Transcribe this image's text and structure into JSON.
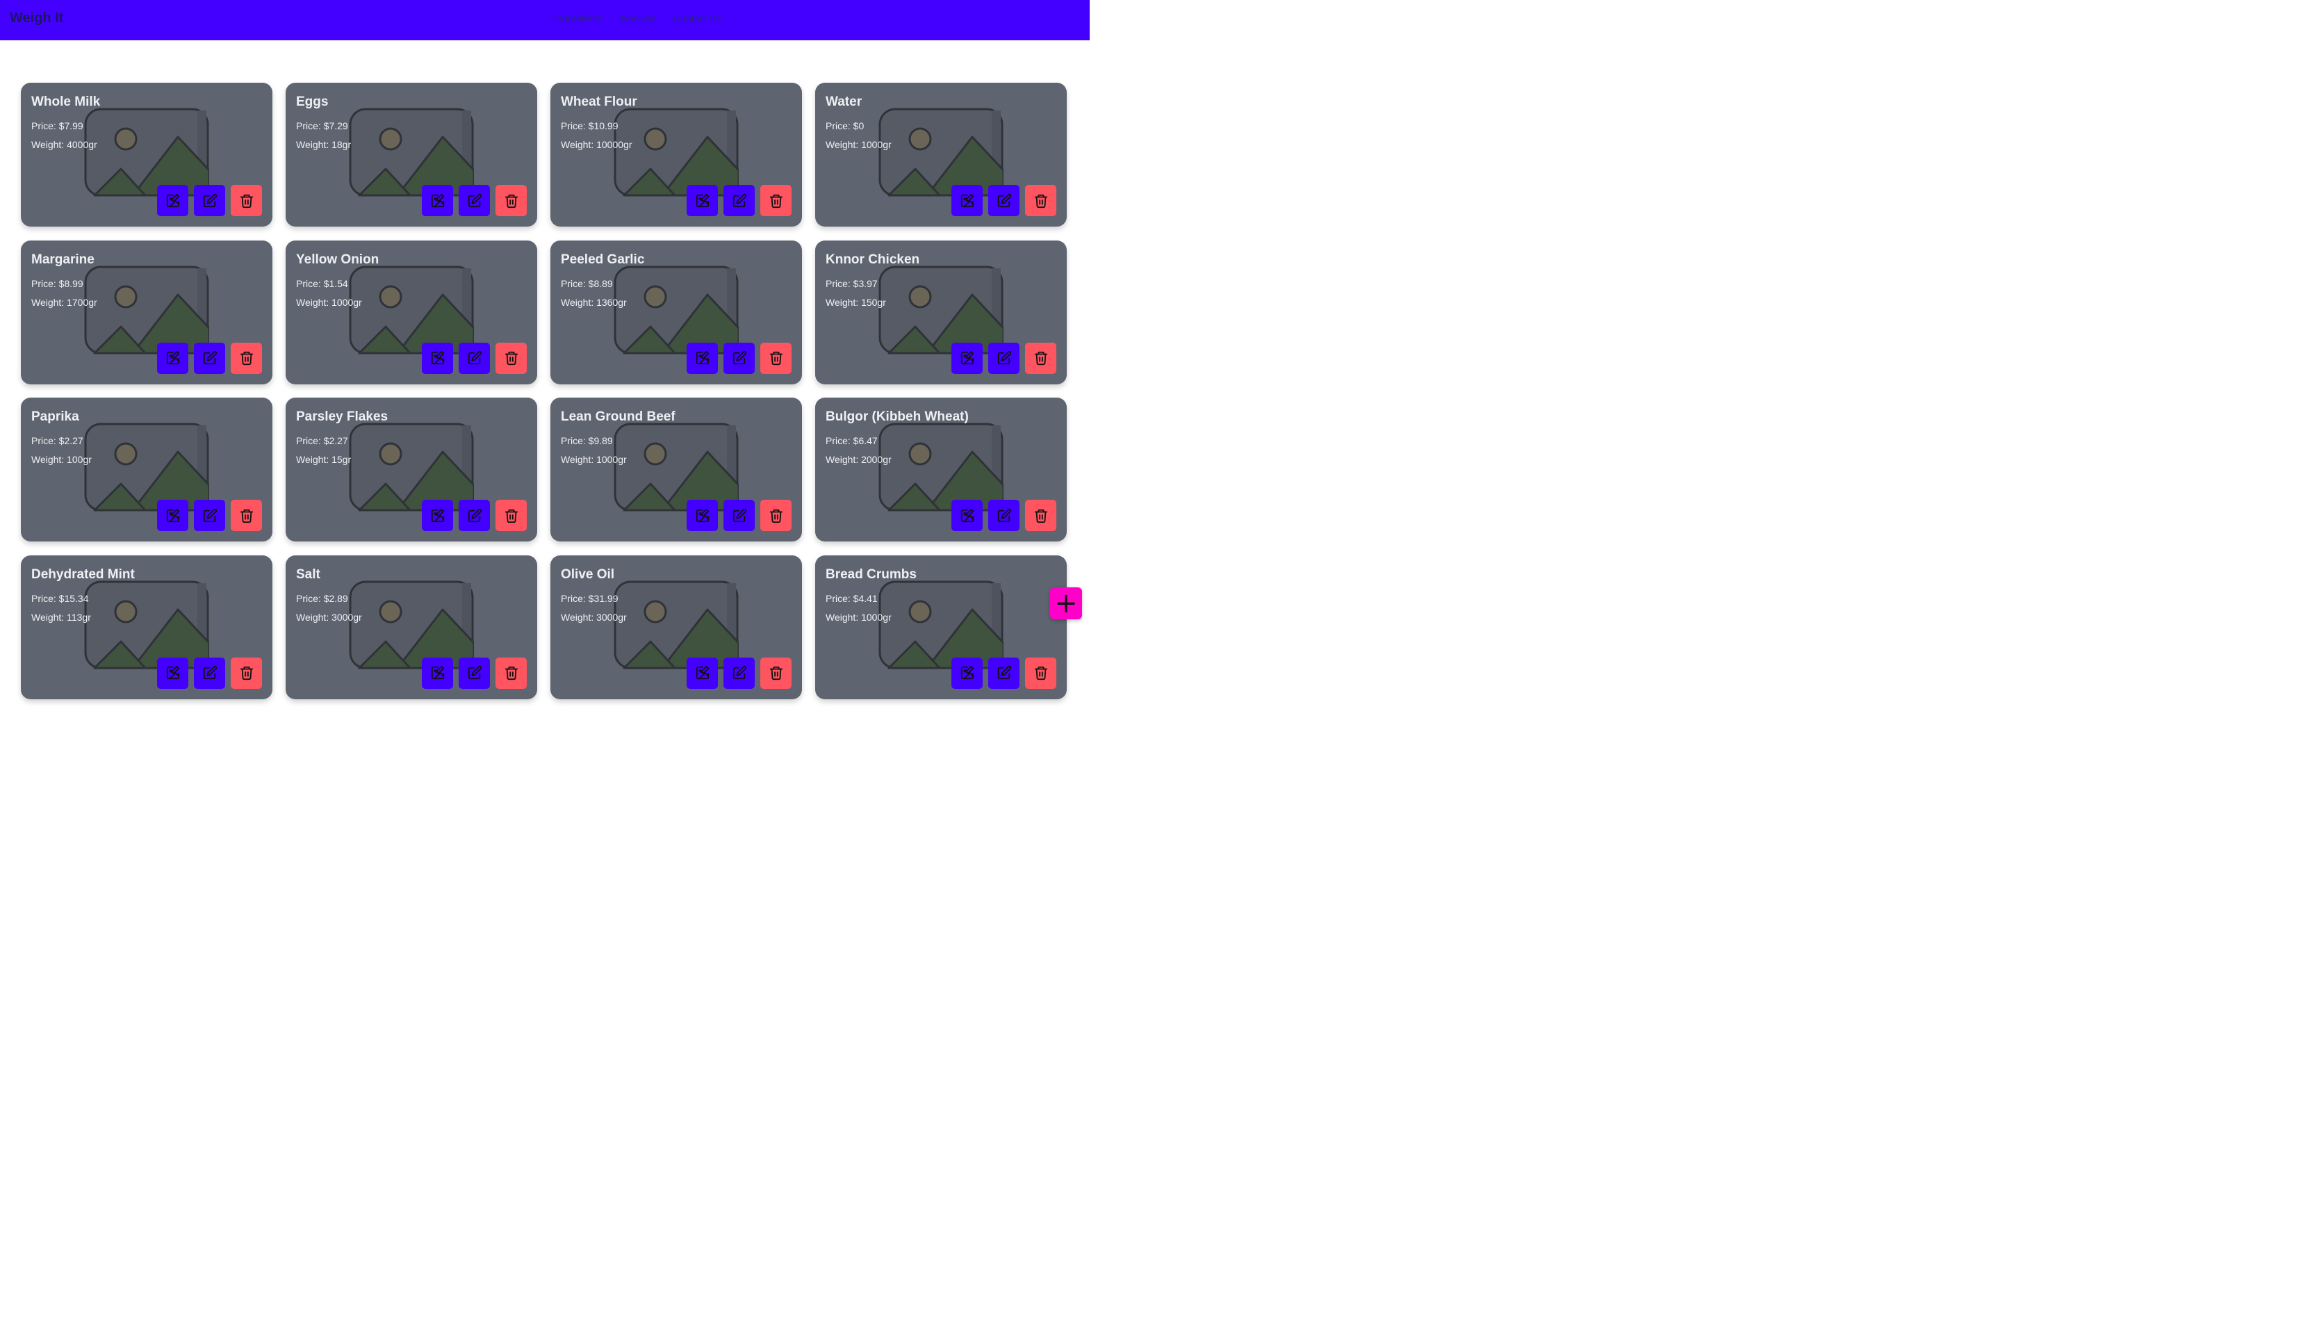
{
  "header": {
    "brand": "Weigh It",
    "nav": [
      "Ingredients",
      "Recipes",
      "Contact Us"
    ]
  },
  "ingredients": [
    {
      "name": "Whole Milk",
      "price": "Price: $7.99",
      "weight": "Weight: 4000gr"
    },
    {
      "name": "Eggs",
      "price": "Price: $7.29",
      "weight": "Weight: 18gr"
    },
    {
      "name": "Wheat Flour",
      "price": "Price: $10.99",
      "weight": "Weight: 10000gr"
    },
    {
      "name": "Water",
      "price": "Price: $0",
      "weight": "Weight: 1000gr"
    },
    {
      "name": "Margarine",
      "price": "Price: $8.99",
      "weight": "Weight: 1700gr"
    },
    {
      "name": "Yellow Onion",
      "price": "Price: $1.54",
      "weight": "Weight: 1000gr"
    },
    {
      "name": "Peeled Garlic",
      "price": "Price: $8.89",
      "weight": "Weight: 1360gr"
    },
    {
      "name": "Knnor Chicken",
      "price": "Price: $3.97",
      "weight": "Weight: 150gr"
    },
    {
      "name": "Paprika",
      "price": "Price: $2.27",
      "weight": "Weight: 100gr"
    },
    {
      "name": "Parsley Flakes",
      "price": "Price: $2.27",
      "weight": "Weight: 15gr"
    },
    {
      "name": "Lean Ground Beef",
      "price": "Price: $9.89",
      "weight": "Weight: 1000gr"
    },
    {
      "name": "Bulgor (Kibbeh Wheat)",
      "price": "Price: $6.47",
      "weight": "Weight: 2000gr"
    },
    {
      "name": "Dehydrated Mint",
      "price": "Price: $15.34",
      "weight": "Weight: 113gr"
    },
    {
      "name": "Salt",
      "price": "Price: $2.89",
      "weight": "Weight: 3000gr"
    },
    {
      "name": "Olive Oil",
      "price": "Price: $31.99",
      "weight": "Weight: 3000gr"
    },
    {
      "name": "Bread Crumbs",
      "price": "Price: $4.41",
      "weight": "Weight: 1000gr"
    }
  ],
  "card_actions": [
    "image-edit-icon",
    "edit-icon",
    "trash-icon"
  ],
  "fab": {
    "icon": "plus-icon",
    "label": "+"
  },
  "colors": {
    "navbar": "#4400ff",
    "card": "#5f6570",
    "action_button": "#4400ff",
    "delete_button": "#ff5560",
    "fab": "#ff00c8"
  }
}
